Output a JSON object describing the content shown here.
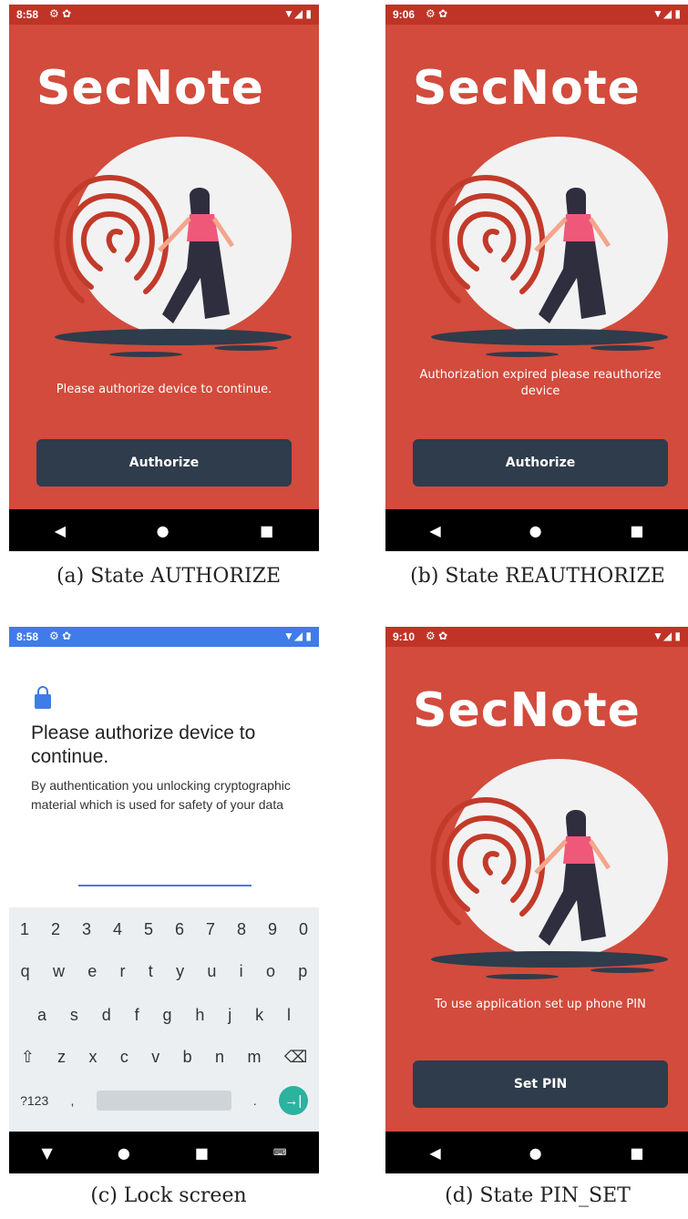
{
  "screens": [
    {
      "time": "8:58",
      "title": "SecNote",
      "message": "Please authorize device to continue.",
      "button": "Authorize",
      "caption": "(a) State AUTHORIZE"
    },
    {
      "time": "9:06",
      "title": "SecNote",
      "message": "Authorization expired please reauthorize device",
      "button": "Authorize",
      "caption": "(b) State REAUTHORIZE"
    },
    {
      "time": "8:58",
      "lock_title": "Please authorize device to continue.",
      "lock_desc": "By authentication you unlocking cryptographic material which is used for safety of your data",
      "keyboard": {
        "row1": [
          "1",
          "2",
          "3",
          "4",
          "5",
          "6",
          "7",
          "8",
          "9",
          "0"
        ],
        "row2": [
          "q",
          "w",
          "e",
          "r",
          "t",
          "y",
          "u",
          "i",
          "o",
          "p"
        ],
        "row3": [
          "a",
          "s",
          "d",
          "f",
          "g",
          "h",
          "j",
          "k",
          "l"
        ],
        "row4": [
          "z",
          "x",
          "c",
          "v",
          "b",
          "n",
          "m"
        ],
        "mode_key": "?123",
        "comma": ",",
        "period": "."
      },
      "caption": "(c) Lock screen"
    },
    {
      "time": "9:10",
      "title": "SecNote",
      "message": "To use application set up phone PIN",
      "button": "Set PIN",
      "caption": "(d) State PIN_SET"
    }
  ],
  "colors": {
    "background_red": "#d24b3c",
    "statusbar_red": "#bf3426",
    "button_dark": "#2e3c4c",
    "accent_blue": "#3f7ce8",
    "enter_teal": "#2bb3a0"
  },
  "icons": {
    "status_left": "settings-icon",
    "status_right": [
      "wifi-icon",
      "signal-icon",
      "battery-icon"
    ],
    "nav": [
      "back-icon",
      "home-icon",
      "recents-icon"
    ]
  }
}
